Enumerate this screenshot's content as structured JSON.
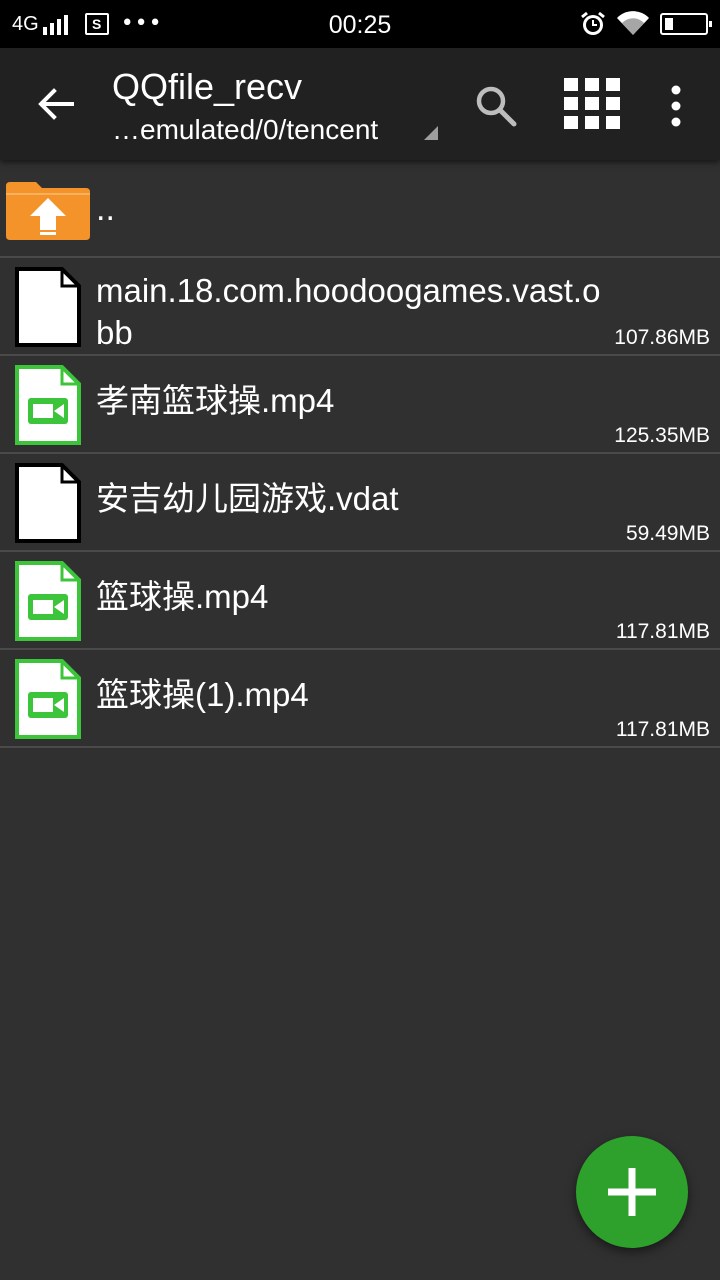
{
  "status_bar": {
    "network": "4G",
    "time": "00:25",
    "screenshot_glyph": "S",
    "more_glyph": "•••",
    "icons": [
      "signal-icon",
      "screenshot-icon",
      "alarm-icon",
      "wifi-icon",
      "battery-icon"
    ]
  },
  "toolbar": {
    "title": "QQfile_recv",
    "path": "…emulated/0/tencent",
    "icons": [
      "back-arrow-icon",
      "search-icon",
      "grid-view-icon",
      "overflow-menu-icon"
    ]
  },
  "files": {
    "parent": {
      "name": "..",
      "icon": "folder-up-icon"
    },
    "items": [
      {
        "name": "main.18.com.hoodoogames.vast.obb",
        "size": "107.86MB",
        "type": "generic"
      },
      {
        "name": "孝南篮球操.mp4",
        "size": "125.35MB",
        "type": "video"
      },
      {
        "name": "安吉幼儿园游戏.vdat",
        "size": "59.49MB",
        "type": "generic"
      },
      {
        "name": "篮球操.mp4",
        "size": "117.81MB",
        "type": "video"
      },
      {
        "name": "篮球操(1).mp4",
        "size": "117.81MB",
        "type": "video"
      }
    ]
  },
  "fab": {
    "icon": "add-icon"
  },
  "colors": {
    "background": "#303030",
    "toolbar": "#212121",
    "accent_green": "#2ea02c",
    "video_icon_green": "#3cc43a",
    "folder_orange": "#f5932b",
    "divider": "#4a4a4a"
  }
}
